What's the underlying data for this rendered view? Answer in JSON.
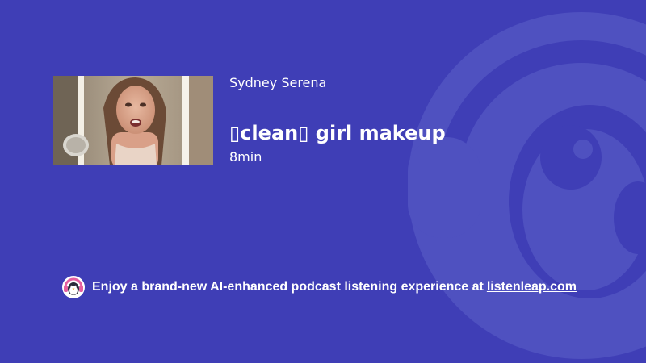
{
  "colors": {
    "background": "#3f3eb6",
    "text": "#ffffff",
    "mascot_watermark": "#4f51c0"
  },
  "episode": {
    "channel": "Sydney Serena",
    "title": "​clean​ girl makeup",
    "title_display": "▯clean▯ girl makeup",
    "duration": "8min"
  },
  "promo": {
    "text": "Enjoy a brand-new AI-enhanced podcast listening experience at",
    "link_text": "listenleap.com",
    "logo_icon": "penguin-headphones-icon"
  }
}
